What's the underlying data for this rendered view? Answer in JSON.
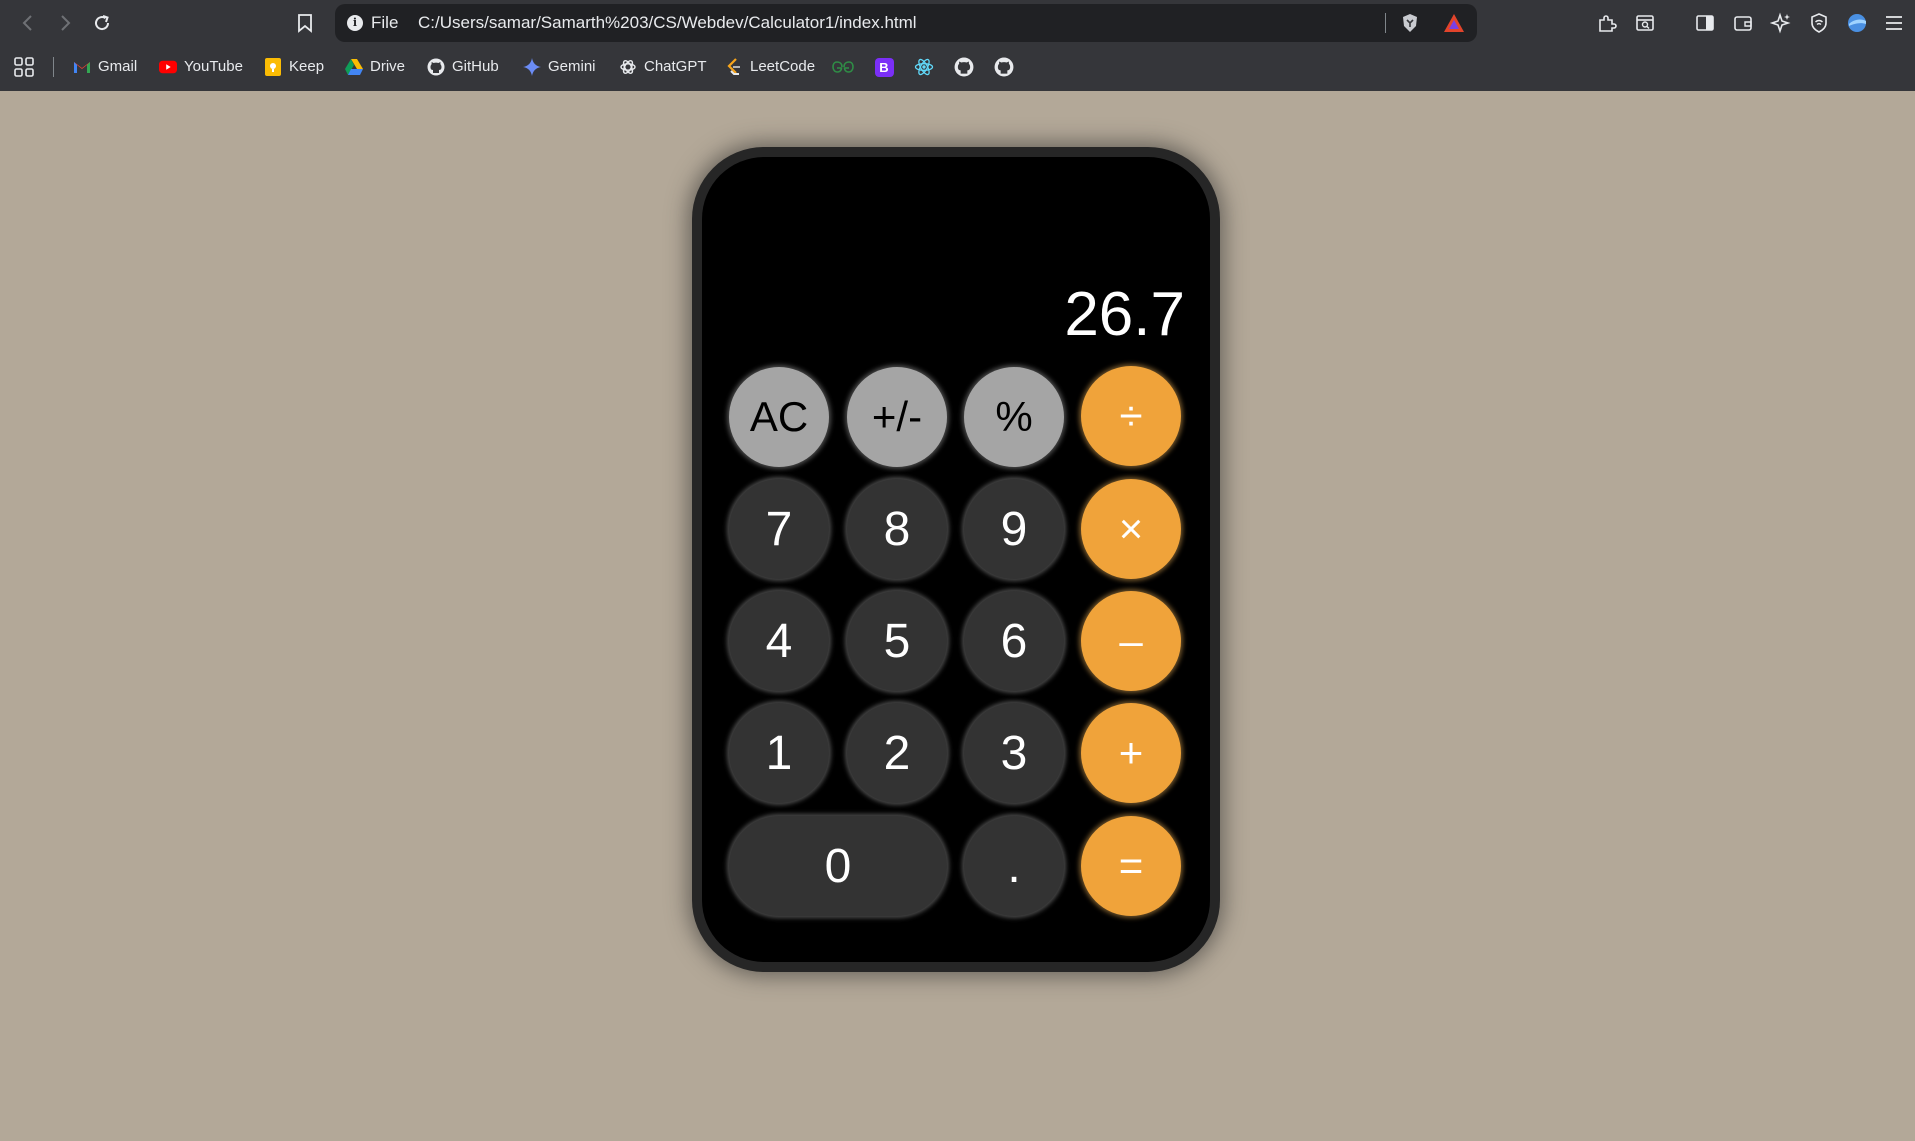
{
  "browser": {
    "url_scheme": "File",
    "url": "C:/Users/samar/Samarth%203/CS/Webdev/Calculator1/index.html",
    "bookmarks": [
      {
        "label": "Gmail",
        "icon": "gmail-icon"
      },
      {
        "label": "YouTube",
        "icon": "youtube-icon"
      },
      {
        "label": "Keep",
        "icon": "keep-icon"
      },
      {
        "label": "Drive",
        "icon": "drive-icon"
      },
      {
        "label": "GitHub",
        "icon": "github-icon"
      },
      {
        "label": "Gemini",
        "icon": "gemini-icon"
      },
      {
        "label": "ChatGPT",
        "icon": "chatgpt-icon"
      },
      {
        "label": "LeetCode",
        "icon": "leetcode-icon"
      }
    ],
    "bookmark_icons_only": [
      "geeksforgeeks-icon",
      "bootstrap-icon",
      "react-icon",
      "github-icon",
      "github-icon"
    ],
    "bootstrap_letter": "B"
  },
  "calculator": {
    "display": "26.7",
    "keys": [
      {
        "label": "AC",
        "kind": "func"
      },
      {
        "label": "+/-",
        "kind": "func"
      },
      {
        "label": "%",
        "kind": "func"
      },
      {
        "label": "÷",
        "kind": "op"
      },
      {
        "label": "7",
        "kind": "num"
      },
      {
        "label": "8",
        "kind": "num"
      },
      {
        "label": "9",
        "kind": "num"
      },
      {
        "label": "×",
        "kind": "op"
      },
      {
        "label": "4",
        "kind": "num"
      },
      {
        "label": "5",
        "kind": "num"
      },
      {
        "label": "6",
        "kind": "num"
      },
      {
        "label": "–",
        "kind": "op"
      },
      {
        "label": "1",
        "kind": "num"
      },
      {
        "label": "2",
        "kind": "num"
      },
      {
        "label": "3",
        "kind": "num"
      },
      {
        "label": "+",
        "kind": "op"
      },
      {
        "label": "0",
        "kind": "num"
      },
      {
        "label": ".",
        "kind": "num"
      },
      {
        "label": "=",
        "kind": "op"
      }
    ]
  },
  "colors": {
    "page_background": "#b3a898",
    "calculator_body": "#000000",
    "function_key": "#a5a5a5",
    "number_key": "#333333",
    "operator_key": "#f0a33a"
  }
}
